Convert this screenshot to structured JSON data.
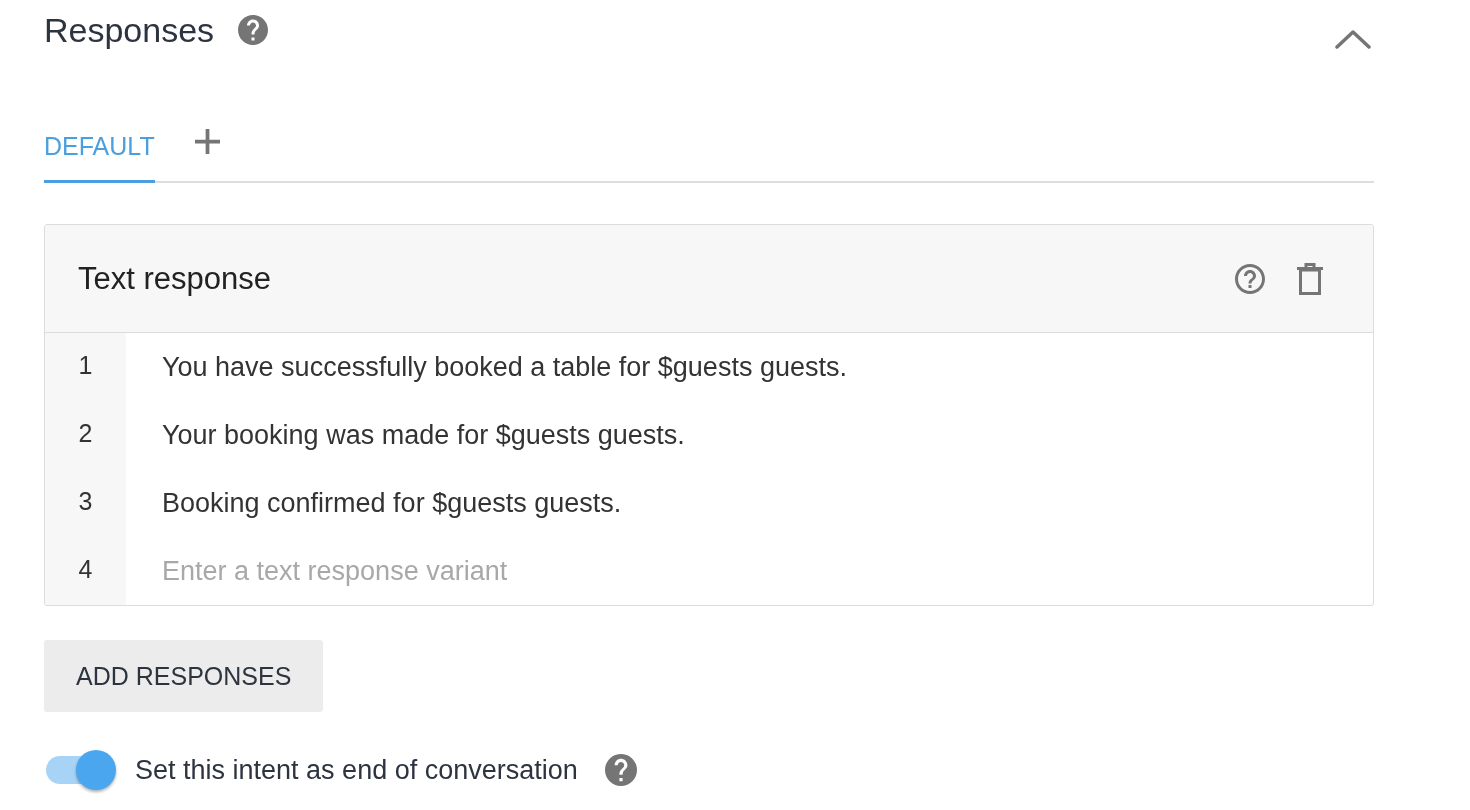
{
  "section": {
    "title": "Responses",
    "expanded": true
  },
  "tabs": [
    {
      "label": "DEFAULT",
      "selected": true
    }
  ],
  "text_response": {
    "title": "Text response",
    "rows": [
      {
        "number": "1",
        "value": "You have successfully booked a table for $guests guests."
      },
      {
        "number": "2",
        "value": "Your booking was made for $guests guests."
      },
      {
        "number": "3",
        "value": "Booking confirmed for $guests guests."
      },
      {
        "number": "4",
        "placeholder": "Enter a text response variant"
      }
    ]
  },
  "add_button": {
    "label": "ADD RESPONSES"
  },
  "end_of_conversation": {
    "label": "Set this intent as end of conversation",
    "on": true
  }
}
